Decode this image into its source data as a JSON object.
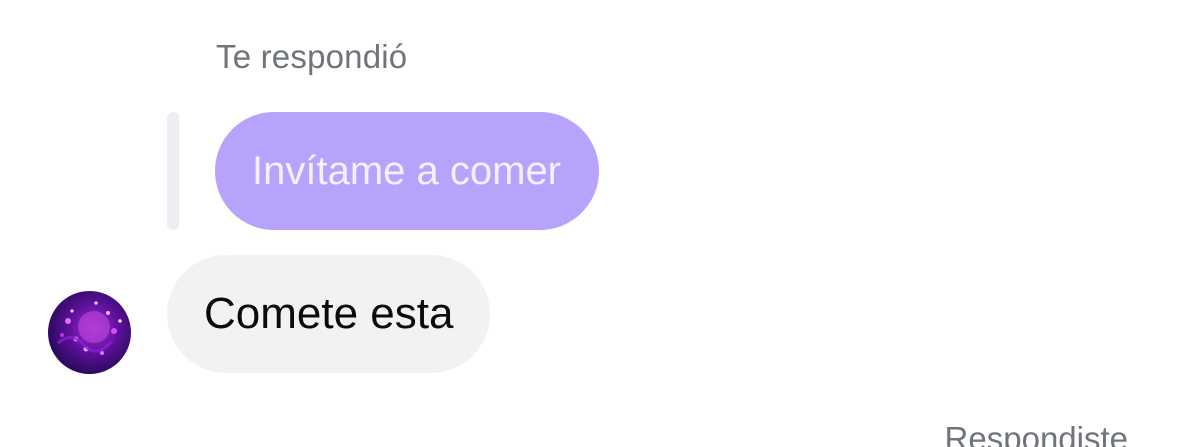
{
  "reply_context": {
    "header": "Te respondió",
    "quoted_message": "Invítame a comer"
  },
  "incoming_message": {
    "text": "Comete esta",
    "avatar": "avatar-photo"
  },
  "footer": {
    "label": "Respondiste"
  },
  "colors": {
    "quoted_bubble": "#b7a3fb",
    "incoming_bubble": "#f1f2f4",
    "meta_text": "#6f737b"
  }
}
